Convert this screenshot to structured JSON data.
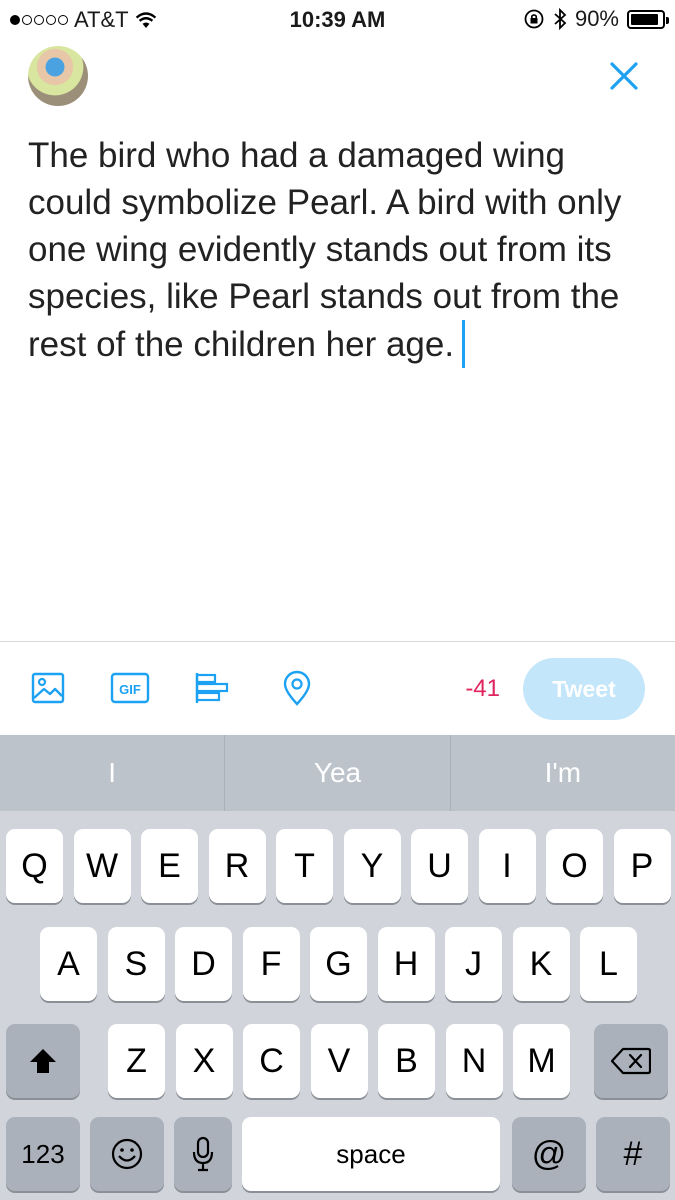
{
  "status_bar": {
    "carrier": "AT&T",
    "time": "10:39 AM",
    "battery": "90%",
    "battery_level": 0.9,
    "signal_bars": 1
  },
  "header": {
    "avatar": "profile-photo",
    "close_icon": "close-x-icon"
  },
  "composer": {
    "text": "The bird who had a damaged wing could symbolize Pearl. A bird with only one wing evidently stands out from its species, like Pearl stands out from the rest of the children her age."
  },
  "toolbar": {
    "icons": [
      "image-icon",
      "gif-icon",
      "poll-icon",
      "location-pin-icon"
    ],
    "gif_label": "GIF",
    "char_count": "-41",
    "tweet_label": "Tweet"
  },
  "keyboard": {
    "suggestions": [
      "I",
      "Yea",
      "I'm"
    ],
    "row1": [
      "Q",
      "W",
      "E",
      "R",
      "T",
      "Y",
      "U",
      "I",
      "O",
      "P"
    ],
    "row2": [
      "A",
      "S",
      "D",
      "F",
      "G",
      "H",
      "J",
      "K",
      "L"
    ],
    "row3": [
      "Z",
      "X",
      "C",
      "V",
      "B",
      "N",
      "M"
    ],
    "numbers_label": "123",
    "space_label": "space",
    "at_label": "@",
    "hash_label": "#"
  },
  "colors": {
    "accent": "#1da1f2",
    "count_negative": "#e0245e",
    "tweet_disabled": "#c3e6fa"
  }
}
